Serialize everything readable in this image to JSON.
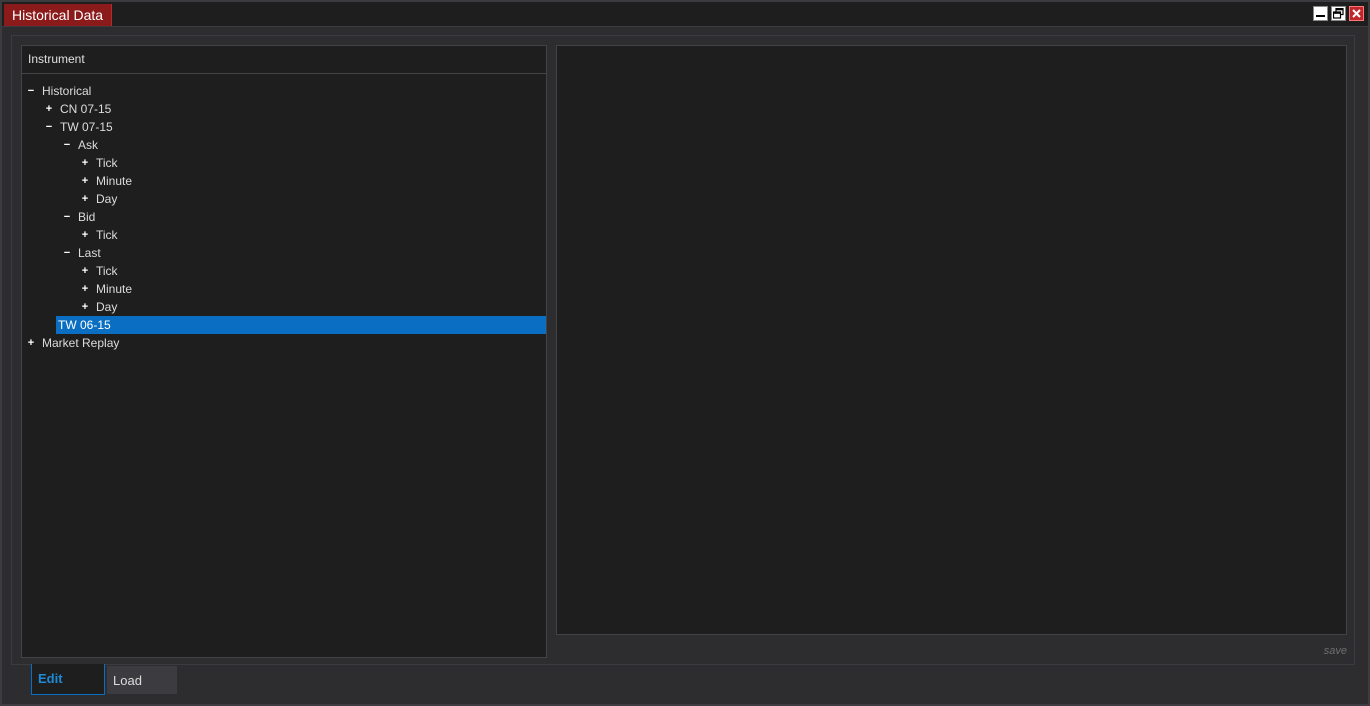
{
  "window": {
    "title": "Historical Data",
    "controls": {
      "minimize_icon": "minimize-icon",
      "restore_icon": "restore-icon",
      "close_icon": "close-icon"
    }
  },
  "left_panel": {
    "header": "Instrument",
    "tree": [
      {
        "label": "Historical",
        "toggle": "−",
        "level": 0
      },
      {
        "label": "CN 07-15",
        "toggle": "+",
        "level": 1
      },
      {
        "label": "TW 07-15",
        "toggle": "−",
        "level": 1
      },
      {
        "label": "Ask",
        "toggle": "−",
        "level": 2
      },
      {
        "label": "Tick",
        "toggle": "+",
        "level": 3
      },
      {
        "label": "Minute",
        "toggle": "+",
        "level": 3
      },
      {
        "label": "Day",
        "toggle": "+",
        "level": 3
      },
      {
        "label": "Bid",
        "toggle": "−",
        "level": 2
      },
      {
        "label": "Tick",
        "toggle": "+",
        "level": 3
      },
      {
        "label": "Last",
        "toggle": "−",
        "level": 2
      },
      {
        "label": "Tick",
        "toggle": "+",
        "level": 3
      },
      {
        "label": "Minute",
        "toggle": "+",
        "level": 3
      },
      {
        "label": "Day",
        "toggle": "+",
        "level": 3
      },
      {
        "label": "TW 06-15",
        "toggle": "",
        "level": 1,
        "selected": true
      },
      {
        "label": "Market Replay",
        "toggle": "+",
        "level": 0
      }
    ]
  },
  "right_panel": {
    "save_label": "save"
  },
  "bottom_tabs": [
    {
      "label": "Edit",
      "active": true
    },
    {
      "label": "Load",
      "active": false
    }
  ],
  "colors": {
    "title_accent": "#8b1a1a",
    "selection": "#0a6fc2",
    "active_tab_text": "#1e8ad6"
  }
}
